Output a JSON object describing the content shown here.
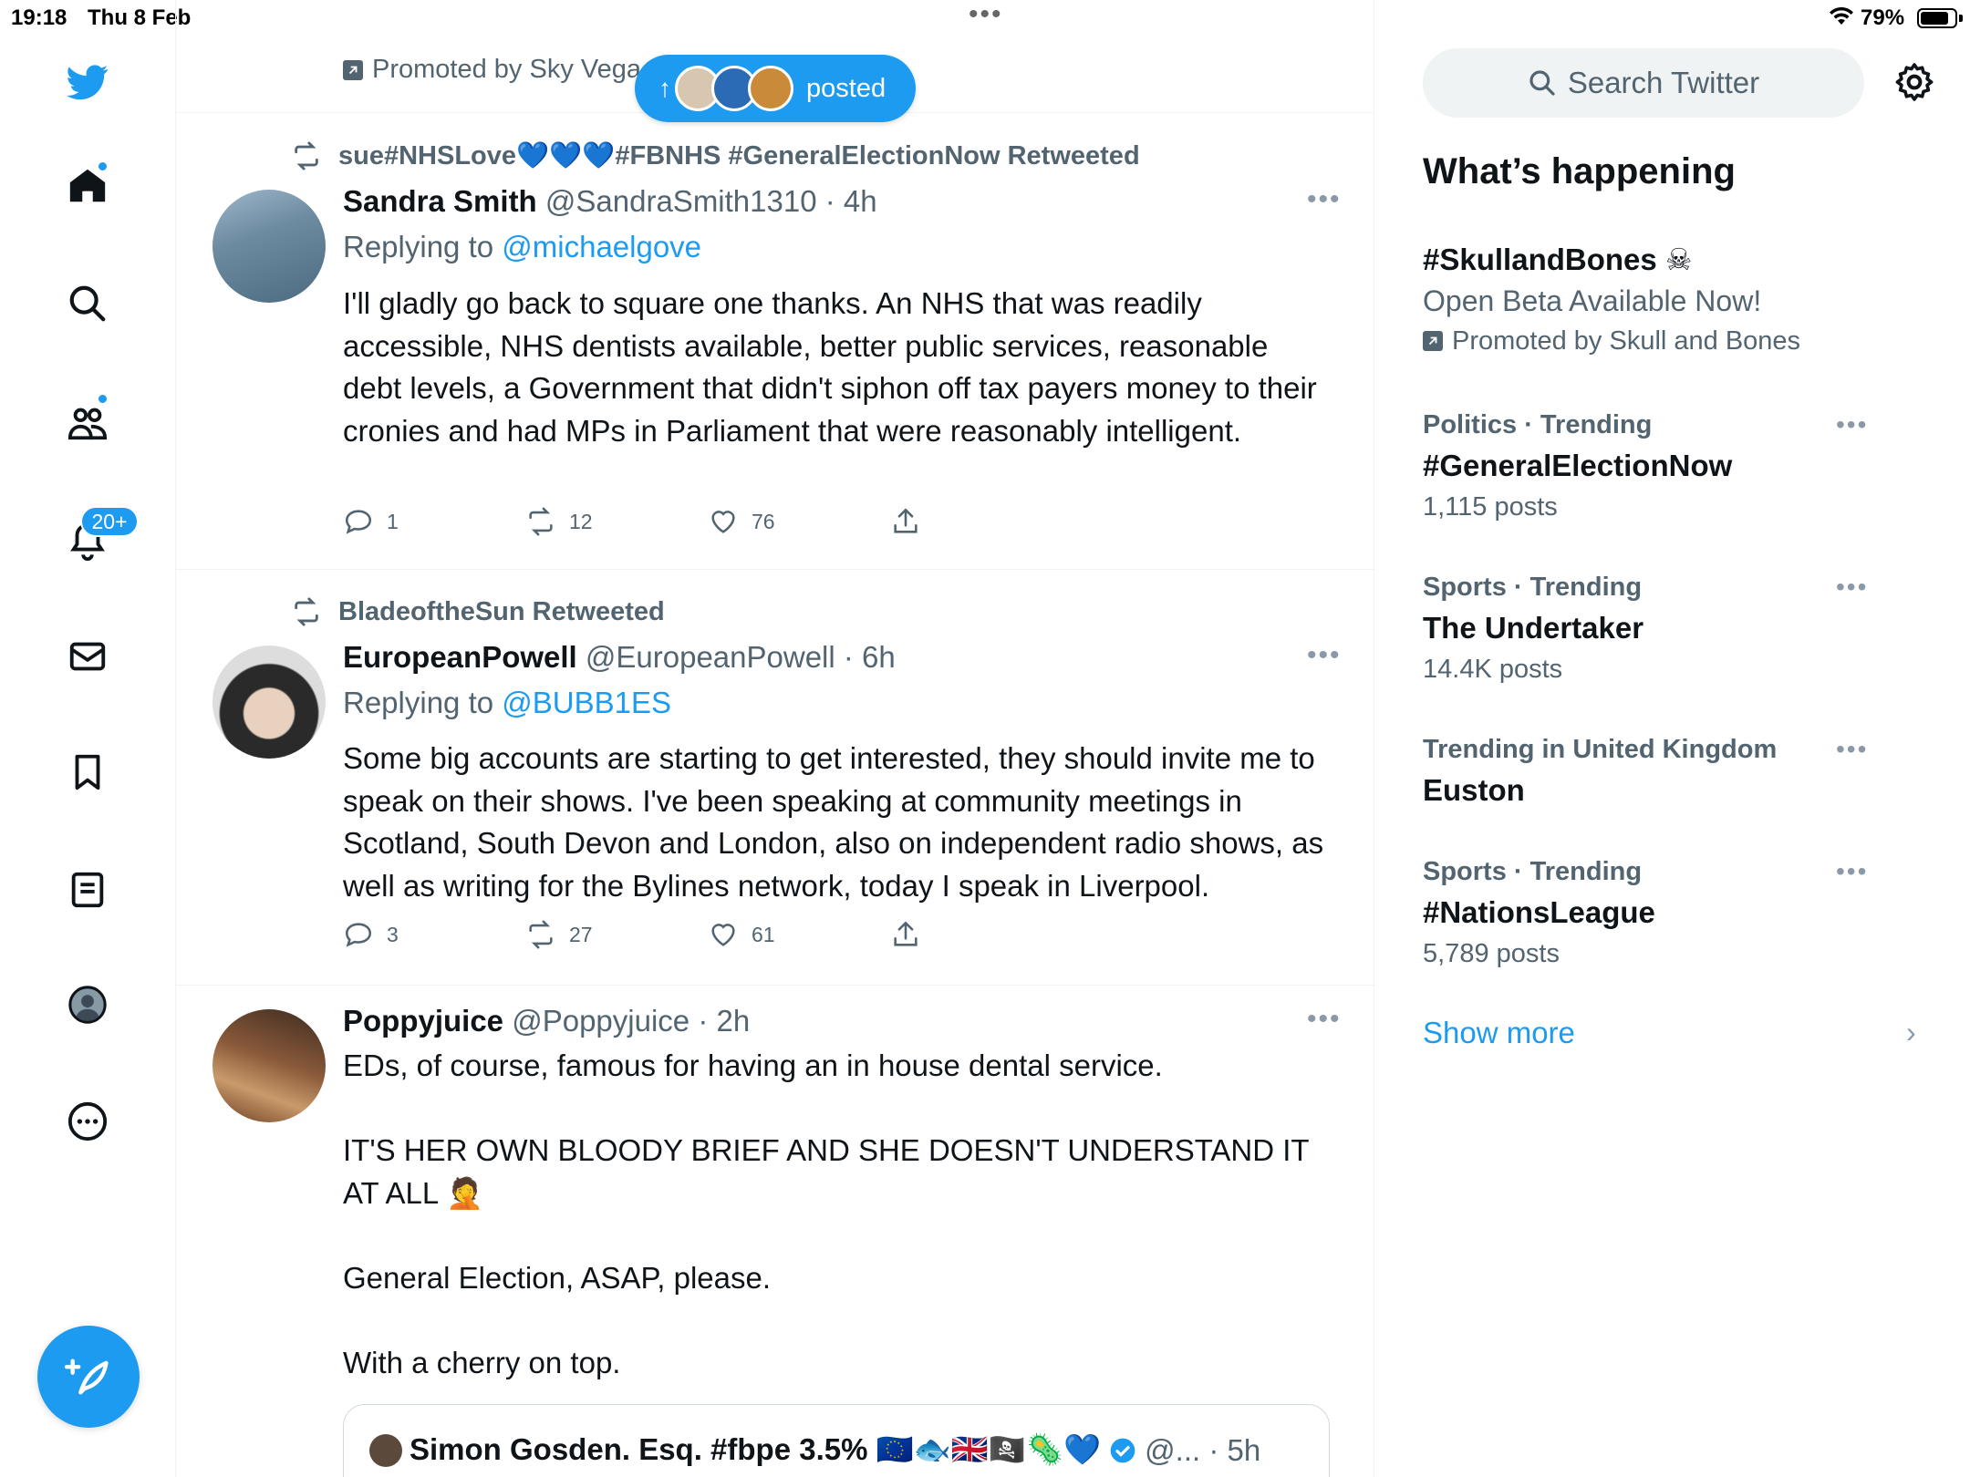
{
  "status_bar": {
    "time": "19:18",
    "date": "Thu 8 Feb",
    "battery": "79%"
  },
  "sidebar": {
    "notifications_badge": "20+",
    "items": [
      "home-icon",
      "search-icon",
      "communities-icon",
      "notifications-icon",
      "messages-icon",
      "bookmarks-icon",
      "lists-icon",
      "profile-icon",
      "more-icon"
    ]
  },
  "timeline": {
    "top_promoted": "Promoted by Sky Vega",
    "posted_pill_label": "posted",
    "tweets": [
      {
        "retweeted_by": "sue#NHSLove💙💙💙#FBNHS #GeneralElectionNow Retweeted",
        "name": "Sandra Smith",
        "handle": "@SandraSmith1310 · 4h",
        "replying_prefix": "Replying to ",
        "replying_to": "@michaelgove",
        "text": "I'll gladly go back to square one thanks. An NHS that was readily accessible, NHS dentists available, better public services, reasonable debt levels, a Government that didn't siphon off tax payers money to their cronies and had MPs in Parliament that were reasonably intelligent.",
        "replies": "1",
        "retweets": "12",
        "likes": "76"
      },
      {
        "retweeted_by": "BladeoftheSun Retweeted",
        "name": "EuropeanPowell",
        "handle": "@EuropeanPowell · 6h",
        "replying_prefix": "Replying to ",
        "replying_to": "@BUBB1ES",
        "text": "Some big accounts are starting to get interested, they should invite me to speak on their shows. I've been speaking at community meetings in Scotland, South Devon and London, also on independent radio shows, as well as writing for the Bylines network, today I speak in Liverpool.",
        "replies": "3",
        "retweets": "27",
        "likes": "61"
      },
      {
        "name": "Poppyjuice",
        "handle": "@Poppyjuice · 2h",
        "text": "EDs, of course, famous for having an in house dental service.\n\nIT'S HER OWN BLOODY BRIEF AND SHE DOESN'T UNDERSTAND IT AT ALL 🤦\n\nGeneral Election, ASAP, please.\n\nWith a cherry on top.",
        "quote": {
          "name": "Simon Gosden. Esq. #fbpe 3.5% 🇪🇺🐟🇬🇧🏴‍☠️🦠💙",
          "handle": "@... · 5h"
        }
      }
    ]
  },
  "right": {
    "search_placeholder": "Search Twitter",
    "whats_happening": "What’s happening",
    "promoted_trend": {
      "name": "#SkullandBones ☠",
      "subtitle": "Open Beta Available Now!",
      "promoted": "Promoted by Skull and Bones"
    },
    "trends": [
      {
        "context": "Politics · Trending",
        "name": "#GeneralElectionNow",
        "count": "1,115 posts"
      },
      {
        "context": "Sports · Trending",
        "name": "The Undertaker",
        "count": "14.4K posts"
      },
      {
        "context": "Trending in United Kingdom",
        "name": "Euston",
        "count": ""
      },
      {
        "context": "Sports · Trending",
        "name": "#NationsLeague",
        "count": "5,789 posts"
      }
    ],
    "show_more": "Show more"
  },
  "colors": {
    "accent": "#1d9bf0",
    "text": "#0f1419",
    "muted": "#536471",
    "divider": "#eff3f4"
  }
}
